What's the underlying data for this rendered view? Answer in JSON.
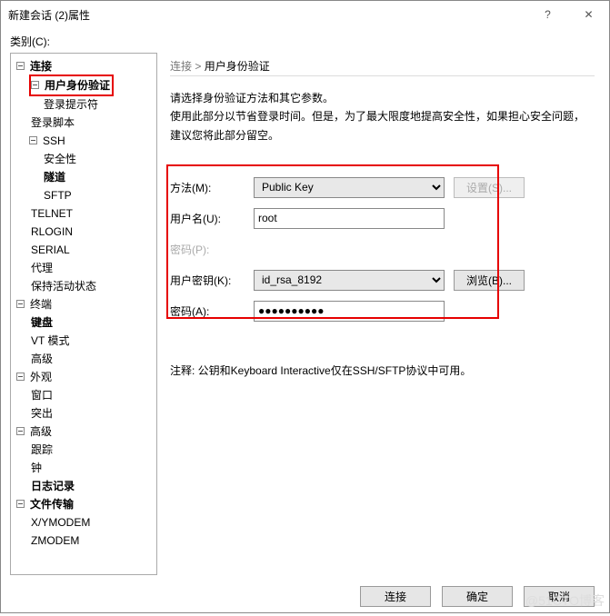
{
  "window": {
    "title": "新建会话 (2)属性",
    "help": "?",
    "close": "✕"
  },
  "category_label": "类别(C):",
  "tree": {
    "connection": "连接",
    "user_auth": "用户身份验证",
    "login_prompt": "登录提示符",
    "login_script": "登录脚本",
    "ssh": "SSH",
    "security": "安全性",
    "tunnel": "隧道",
    "sftp": "SFTP",
    "telnet": "TELNET",
    "rlogin": "RLOGIN",
    "serial": "SERIAL",
    "proxy": "代理",
    "keepalive": "保持活动状态",
    "terminal": "终端",
    "keyboard": "键盘",
    "vtmode": "VT 模式",
    "advanced_term": "高级",
    "appearance": "外观",
    "window": "窗口",
    "highlight": "突出",
    "advanced": "高级",
    "trace": "跟踪",
    "bell": "钟",
    "logging": "日志记录",
    "filetransfer": "文件传输",
    "xymodem": "X/YMODEM",
    "zmodem": "ZMODEM"
  },
  "panel": {
    "crumb_parent": "连接",
    "crumb_sep": " > ",
    "crumb_current": "用户身份验证",
    "desc_line1": "请选择身份验证方法和其它参数。",
    "desc_line2": "使用此部分以节省登录时间。但是，为了最大限度地提高安全性，如果担心安全问题，建议您将此部分留空。",
    "method_label": "方法(M):",
    "method_value": "Public Key",
    "username_label": "用户名(U):",
    "username_value": "root",
    "password_label": "密码(P):",
    "userkey_label": "用户密钥(K):",
    "userkey_value": "id_rsa_8192",
    "passphrase_label": "密码(A):",
    "passphrase_value": "●●●●●●●●●●",
    "setup_btn": "设置(S)...",
    "browse_btn": "浏览(B)...",
    "note": "注释: 公钥和Keyboard Interactive仅在SSH/SFTP协议中可用。"
  },
  "footer": {
    "connect": "连接",
    "ok": "确定",
    "cancel": "取消"
  },
  "watermark": "@51CTO博客"
}
